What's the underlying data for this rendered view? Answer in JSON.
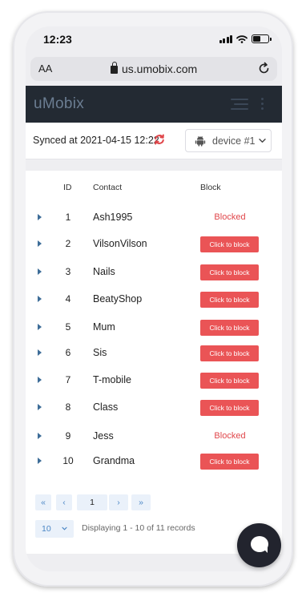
{
  "status_bar": {
    "time": "12:23"
  },
  "browser": {
    "text_size_label": "AA",
    "url": "us.umobix.com"
  },
  "app": {
    "logo": "uMobix"
  },
  "sync": {
    "text": "Synced at 2021-04-15 12:22",
    "device_label": "device #1"
  },
  "table": {
    "headers": {
      "id": "ID",
      "contact": "Contact",
      "block": "Block"
    },
    "rows": [
      {
        "id": "1",
        "contact": "Ash1995",
        "block": "Blocked",
        "blocked": true
      },
      {
        "id": "2",
        "contact": "VilsonVilson",
        "block": "Click to block",
        "blocked": false
      },
      {
        "id": "3",
        "contact": "Nails",
        "block": "Click to block",
        "blocked": false
      },
      {
        "id": "4",
        "contact": "BeatyShop",
        "block": "Click to block",
        "blocked": false
      },
      {
        "id": "5",
        "contact": "Mum",
        "block": "Click to block",
        "blocked": false
      },
      {
        "id": "6",
        "contact": "Sis",
        "block": "Click to block",
        "blocked": false
      },
      {
        "id": "7",
        "contact": "T-mobile",
        "block": "Click to block",
        "blocked": false
      },
      {
        "id": "8",
        "contact": "Class",
        "block": "Click to block",
        "blocked": false
      },
      {
        "id": "9",
        "contact": "Jess",
        "block": "Blocked",
        "blocked": true
      },
      {
        "id": "10",
        "contact": "Grandma",
        "block": "Click to block",
        "blocked": false
      }
    ]
  },
  "pagination": {
    "first": "«",
    "prev": "‹",
    "current": "1",
    "next": "›",
    "last": "»",
    "per_page": "10",
    "records_text": "Displaying 1 - 10 of 11 records"
  },
  "colors": {
    "accent_red": "#ea5456",
    "appbar": "#232a33",
    "link_blue": "#4b86c5"
  }
}
